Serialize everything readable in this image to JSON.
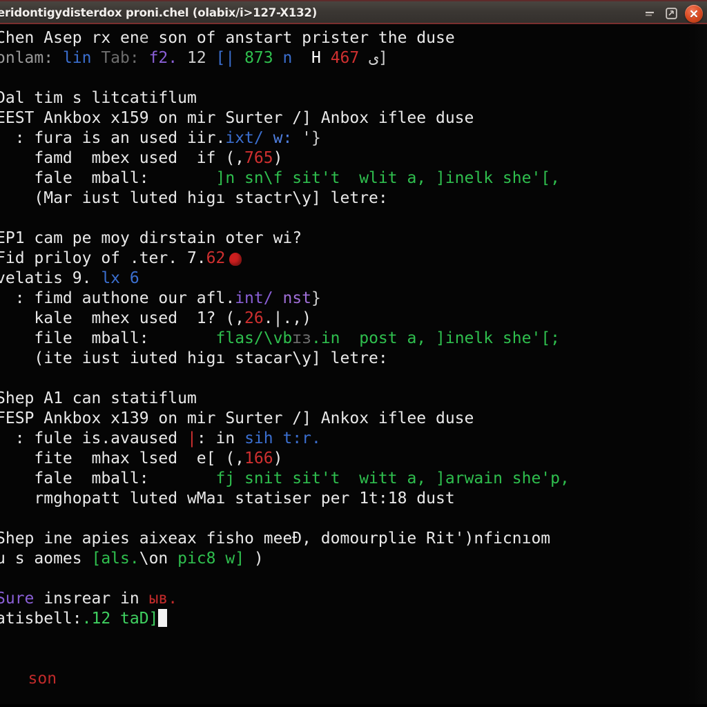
{
  "window": {
    "title": "eridontigydisterdox proni.chel (olabix/i>127-X132)",
    "titlebar_bg": "#3b3733",
    "accent_top": "#5e2a2a",
    "close_color": "#db4b22"
  },
  "buttons": {
    "minimize_label": "minimize",
    "maximize_label": "maximize",
    "close_label": "close"
  },
  "terminal": {
    "background": "#050505",
    "default_fg": "#e9e9e9",
    "font_size_px": 23,
    "line_height_px": 29,
    "cursor_color": "#f2f2f2",
    "lines": [
      {
        "id": "l01",
        "spans": [
          {
            "text": "Chen Asep rx en",
            "color": "#e9e9e9"
          },
          {
            "text": "e",
            "color": "#cfcfcf"
          },
          {
            "text": " son of anstart prister the duse",
            "color": "#e9e9e9"
          }
        ]
      },
      {
        "id": "l02",
        "spans": [
          {
            "text": "onlam: ",
            "color": "#9a9a9a"
          },
          {
            "text": "lin ",
            "color": "#3b6fd0"
          },
          {
            "text": "Tab: ",
            "color": "#6e6e6e"
          },
          {
            "text": "f2. ",
            "color": "#8a5fd6"
          },
          {
            "text": "12 ",
            "color": "#cfcfcf"
          },
          {
            "text": "[| ",
            "color": "#3b6fd0"
          },
          {
            "text": "873 ",
            "color": "#2fbf4e"
          },
          {
            "text": "n",
            "color": "#3b6fd0"
          },
          {
            "text": "  H ",
            "color": "#ffffff"
          },
          {
            "text": "467",
            "color": "#d03030"
          },
          {
            "text": " ى]",
            "color": "#cfcfcf"
          }
        ]
      },
      {
        "id": "l03",
        "spans": [
          {
            "text": " ",
            "color": "#e9e9e9"
          }
        ]
      },
      {
        "id": "l04",
        "spans": [
          {
            "text": "Dal tim s litcatiflum",
            "color": "#e9e9e9"
          }
        ]
      },
      {
        "id": "l05",
        "spans": [
          {
            "text": "EEST Ankbox x159 on mir Surter /] Anbox iflee duse",
            "color": "#e9e9e9"
          }
        ]
      },
      {
        "id": "l06",
        "spans": [
          {
            "text": "  : fura is an used iir.",
            "color": "#e9e9e9"
          },
          {
            "text": "ixt/ ",
            "color": "#3b6fd0"
          },
          {
            "text": "w: ",
            "color": "#4f7fe0"
          },
          {
            "text": "'}",
            "color": "#cfcfcf"
          }
        ]
      },
      {
        "id": "l07",
        "spans": [
          {
            "text": "    famd  mbex used  if (,",
            "color": "#e9e9e9"
          },
          {
            "text": "765",
            "color": "#d03030"
          },
          {
            "text": ")",
            "color": "#e9e9e9"
          }
        ]
      },
      {
        "id": "l08",
        "spans": [
          {
            "text": "    fale  mball:       ",
            "color": "#e9e9e9"
          },
          {
            "text": "]n sn\\f sit't  wlit a, ]inelk she'[,",
            "color": "#2fbf4e"
          }
        ]
      },
      {
        "id": "l09",
        "spans": [
          {
            "text": "    (Mar iust luted higı stactr\\y] letre:",
            "color": "#e9e9e9"
          }
        ]
      },
      {
        "id": "l10",
        "spans": [
          {
            "text": " ",
            "color": "#e9e9e9"
          }
        ]
      },
      {
        "id": "l11",
        "spans": [
          {
            "text": "EP1 cam pe moy dirstain oter wi?",
            "color": "#e9e9e9"
          }
        ]
      },
      {
        "id": "l12",
        "spans": [
          {
            "text": "Fid priloy of .ter. 7.",
            "color": "#e9e9e9"
          },
          {
            "text": "62",
            "color": "#d03030"
          },
          {
            "text": "",
            "color": "#e9e9e9",
            "marker": "red-dot"
          }
        ]
      },
      {
        "id": "l13",
        "spans": [
          {
            "text": "velatis 9. ",
            "color": "#e9e9e9"
          },
          {
            "text": "lx 6",
            "color": "#3b6fd0"
          }
        ]
      },
      {
        "id": "l14",
        "spans": [
          {
            "text": "  : fimd authone our afl.",
            "color": "#e9e9e9"
          },
          {
            "text": "int/ ",
            "color": "#8a5fd6"
          },
          {
            "text": "nst",
            "color": "#a06fd8"
          },
          {
            "text": "}",
            "color": "#cfcfcf"
          }
        ]
      },
      {
        "id": "l15",
        "spans": [
          {
            "text": "    kale  mhex used  1? (,",
            "color": "#e9e9e9"
          },
          {
            "text": "26",
            "color": "#d03030"
          },
          {
            "text": ".|.,)",
            "color": "#e9e9e9"
          }
        ]
      },
      {
        "id": "l16",
        "spans": [
          {
            "text": "    file  mball:       ",
            "color": "#e9e9e9"
          },
          {
            "text": "flas/\\vb",
            "color": "#2fbf4e"
          },
          {
            "text": "ɪɜ",
            "color": "#6e6e6e"
          },
          {
            "text": ".in  post a, ]inelk she'[;",
            "color": "#2fbf4e"
          }
        ]
      },
      {
        "id": "l17",
        "spans": [
          {
            "text": "    (ite iust iuted higı stacar\\y] letre:",
            "color": "#e9e9e9"
          }
        ]
      },
      {
        "id": "l18",
        "spans": [
          {
            "text": " ",
            "color": "#e9e9e9"
          }
        ]
      },
      {
        "id": "l19",
        "spans": [
          {
            "text": "Shep A1 can statiflum",
            "color": "#e9e9e9"
          }
        ]
      },
      {
        "id": "l20",
        "spans": [
          {
            "text": "FESP Ankbox x139 on mir Surter /] Ankox iflee duse",
            "color": "#e9e9e9"
          }
        ]
      },
      {
        "id": "l21",
        "spans": [
          {
            "text": "  : fule is.avaused ",
            "color": "#e9e9e9"
          },
          {
            "text": "|",
            "color": "#d03030"
          },
          {
            "text": ": in ",
            "color": "#e9e9e9"
          },
          {
            "text": "sih t:r.",
            "color": "#3b6fd0"
          }
        ]
      },
      {
        "id": "l22",
        "spans": [
          {
            "text": "    fite  mhax lsed  e[ (,",
            "color": "#e9e9e9"
          },
          {
            "text": "166",
            "color": "#d03030"
          },
          {
            "text": ")",
            "color": "#e9e9e9"
          }
        ]
      },
      {
        "id": "l23",
        "spans": [
          {
            "text": "    fale  mball:       ",
            "color": "#e9e9e9"
          },
          {
            "text": "fj snit sit't  witt a, ]arwain she'p,",
            "color": "#2fbf4e"
          }
        ]
      },
      {
        "id": "l24",
        "spans": [
          {
            "text": "    rmghopatt luted wMaı statiser per 1t:18 dust",
            "color": "#e9e9e9"
          }
        ]
      },
      {
        "id": "l25",
        "spans": [
          {
            "text": " ",
            "color": "#e9e9e9"
          }
        ]
      },
      {
        "id": "l26",
        "spans": [
          {
            "text": "Shep ine apies aixeax fisho meeÐ, domourplie Rit')nficnıom",
            "color": "#e9e9e9"
          }
        ]
      },
      {
        "id": "l27",
        "spans": [
          {
            "text": "u s aomes ",
            "color": "#e9e9e9"
          },
          {
            "text": "[als.",
            "color": "#2fbf4e"
          },
          {
            "text": "\\on ",
            "color": "#e9e9e9"
          },
          {
            "text": "pic8 w]",
            "color": "#2fbf4e"
          },
          {
            "text": " )",
            "color": "#e9e9e9"
          }
        ]
      },
      {
        "id": "l28",
        "spans": [
          {
            "text": " ",
            "color": "#e9e9e9"
          }
        ]
      },
      {
        "id": "l29",
        "spans": [
          {
            "text": "Sure",
            "color": "#8a5fd6"
          },
          {
            "text": " insrear in ",
            "color": "#e9e9e9"
          },
          {
            "text": "ыв.",
            "color": "#c02a2a"
          }
        ]
      },
      {
        "id": "l30",
        "spans": [
          {
            "text": "atisbell:",
            "color": "#e9e9e9"
          },
          {
            "text": ".12 taD]",
            "color": "#3fd060"
          },
          {
            "text": "",
            "color": "#e9e9e9",
            "marker": "cursor"
          }
        ]
      },
      {
        "id": "l31",
        "spans": [
          {
            "text": " ",
            "color": "#e9e9e9"
          }
        ]
      },
      {
        "id": "l32",
        "spans": [
          {
            "text": " ",
            "color": "#e9e9e9"
          }
        ]
      },
      {
        "id": "l33",
        "spans": [
          {
            "text": "",
            "color": "#e9e9e9",
            "marker": "bullet"
          },
          {
            "text": "   ",
            "color": "#e9e9e9"
          },
          {
            "text": "son",
            "color": "#c02a2a"
          }
        ]
      }
    ]
  }
}
